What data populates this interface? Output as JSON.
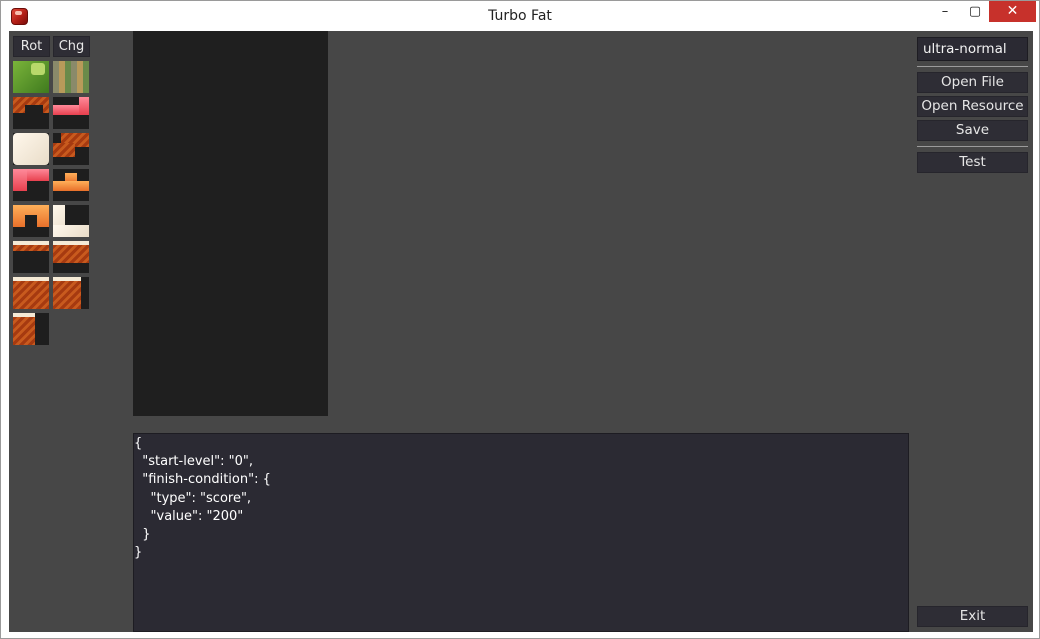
{
  "window": {
    "title": "Turbo Fat",
    "controls": {
      "minimize": "–",
      "maximize": "▢",
      "close": "✕"
    }
  },
  "palette": {
    "rotate_label": "Rot",
    "change_label": "Chg"
  },
  "level_name": {
    "value": "ultra-normal"
  },
  "right_panel": {
    "open_file": "Open File",
    "open_resource": "Open Resource",
    "save": "Save",
    "test": "Test",
    "exit": "Exit"
  },
  "editor": {
    "lines": [
      "{",
      "  \"start-level\": \"0\",",
      "  \"finish-condition\": {",
      "    \"type\": \"score\",",
      "    \"value\": \"200\"",
      "  }",
      "}"
    ]
  },
  "colors": {
    "client_bg": "#474747",
    "board_bg": "#1f1f1f",
    "editor_bg": "#2b2a33",
    "close_button": "#c7312b"
  }
}
